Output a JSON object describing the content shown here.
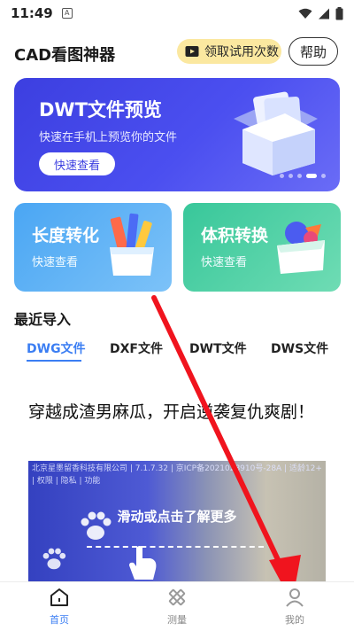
{
  "status_bar": {
    "time": "11:49",
    "a_icon": "A"
  },
  "header": {
    "app_title": "CAD看图神器",
    "trial_label": "领取试用次数",
    "help_label": "帮助"
  },
  "banner": {
    "title": "DWT文件预览",
    "subtitle": "快速在手机上预览你的文件",
    "button_label": "快速查看"
  },
  "cards": [
    {
      "title": "长度转化",
      "subtitle": "快速查看"
    },
    {
      "title": "体积转换",
      "subtitle": "快速查看"
    }
  ],
  "recent": {
    "title": "最近导入"
  },
  "tabs": [
    {
      "label": "DWG文件"
    },
    {
      "label": "DXF文件"
    },
    {
      "label": "DWT文件"
    },
    {
      "label": "DWS文件"
    }
  ],
  "ad": {
    "title": "穿越成渣男麻瓜，开启逆袭复仇爽剧！",
    "info": "北京星墨留香科技有限公司 | 7.1.7.32 | 京ICP备2021028910号-28A | 适龄12+ | 权限 | 隐私 | 功能",
    "hint": "滑动或点击了解更多"
  },
  "nav": [
    {
      "label": "首页"
    },
    {
      "label": "测量"
    },
    {
      "label": "我的"
    }
  ],
  "colors": {
    "accent": "#3b7ef3",
    "banner": "#4245e6",
    "arrow": "#f0141e"
  }
}
